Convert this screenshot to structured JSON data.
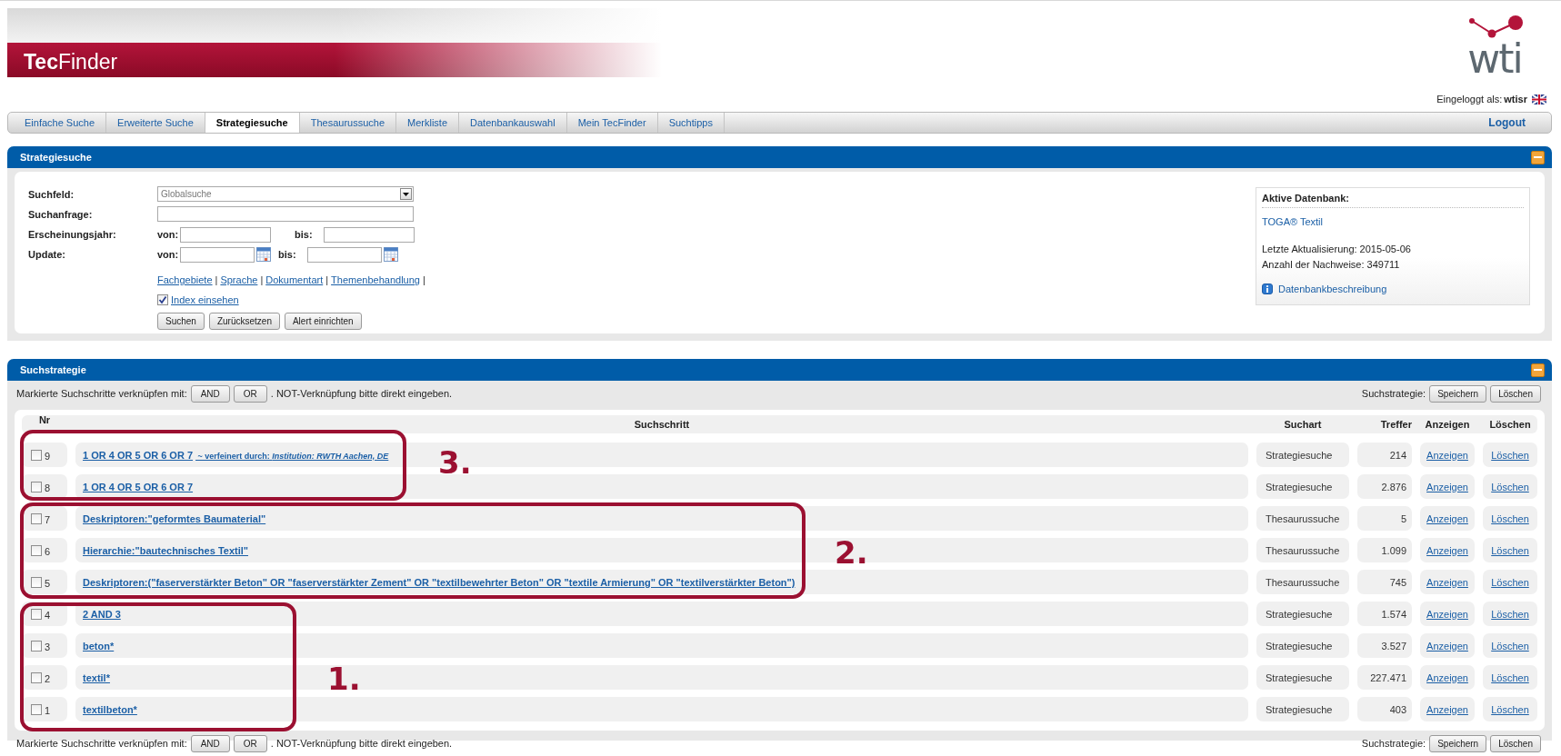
{
  "header": {
    "app_name": "**Tec**Finder",
    "logo": "wti",
    "login_label": "Eingeloggt als:",
    "login_user": "wtisr"
  },
  "tabs": [
    {
      "label": "Einfache Suche",
      "selected": false
    },
    {
      "label": "Erweiterte Suche",
      "selected": false
    },
    {
      "label": "Strategiesuche",
      "selected": true
    },
    {
      "label": "Thesaurussuche",
      "selected": false
    },
    {
      "label": "Merkliste",
      "selected": false
    },
    {
      "label": "Datenbankauswahl",
      "selected": false
    },
    {
      "label": "Mein TecFinder",
      "selected": false
    },
    {
      "label": "Suchtipps",
      "selected": false
    }
  ],
  "logout": "Logout",
  "search_panel": {
    "title": "Strategiesuche",
    "suchfeld": {
      "label": "Suchfeld:",
      "value": "Globalsuche"
    },
    "suchanfrage": {
      "label": "Suchanfrage:"
    },
    "ranges": [
      {
        "label": "Erscheinungsjahr:",
        "from_label": "von:",
        "to_label": "bis:",
        "calendar": false
      },
      {
        "label": "Update:",
        "from_label": "von:",
        "to_label": "bis:",
        "calendar": true
      }
    ],
    "links": [
      "Fachgebiete",
      "Sprache",
      "Dokumentart",
      "Themenbehandlung"
    ],
    "link_separator": "|",
    "index": {
      "label": "Index einsehen",
      "checked": true
    },
    "buttons": [
      "Suchen",
      "Zurücksetzen",
      "Alert einrichten"
    ],
    "database": {
      "title": "Aktive Datenbank:",
      "name": "TOGA® Textil",
      "lines": [
        "Letzte Aktualisierung: 2015-05-06",
        "Anzahl der Nachweise: 349711"
      ],
      "description_link": "Datenbankbeschreibung"
    }
  },
  "strategy_panel": {
    "title": "Suchstrategie",
    "toolbars": [
      {
        "combine_label": "Markierte Suchschritte verknüpfen mit:",
        "buttons": [
          "AND",
          "OR"
        ],
        "note": ". NOT-Verknüpfung bitte direkt eingeben.",
        "save_label": "Suchstrategie:",
        "save_buttons": [
          "Speichern",
          "Löschen"
        ]
      },
      {
        "combine_label": "Markierte Suchschritte verknüpfen mit:",
        "buttons": [
          "AND",
          "OR"
        ],
        "note": ". NOT-Verknüpfung bitte direkt eingeben.",
        "save_label": "Suchstrategie:",
        "save_buttons": [
          "Speichern",
          "Löschen"
        ]
      }
    ],
    "columns": [
      "Nr",
      "Suchschritt",
      "Suchart",
      "Treffer",
      "Anzeigen",
      "Löschen"
    ],
    "rows": [
      {
        "nr": "9",
        "checked": false,
        "step": "1 OR 4 OR 5 OR 6 OR 7",
        "refinement": "~ verfeinert durch: *Institution: RWTH Aachen, DE*",
        "type": "Strategiesuche",
        "hits": "214",
        "show": "Anzeigen",
        "delete": "Löschen"
      },
      {
        "nr": "8",
        "checked": false,
        "step": "1 OR 4 OR 5 OR 6 OR 7",
        "type": "Strategiesuche",
        "hits": "2.876",
        "show": "Anzeigen",
        "delete": "Löschen"
      },
      {
        "nr": "7",
        "checked": false,
        "step": "Deskriptoren:\"geformtes Baumaterial\"",
        "type": "Thesaurussuche",
        "hits": "5",
        "show": "Anzeigen",
        "delete": "Löschen"
      },
      {
        "nr": "6",
        "checked": false,
        "step": "Hierarchie:\"bautechnisches Textil\"",
        "type": "Thesaurussuche",
        "hits": "1.099",
        "show": "Anzeigen",
        "delete": "Löschen"
      },
      {
        "nr": "5",
        "checked": false,
        "step": "Deskriptoren:(\"faserverstärkter Beton\" OR \"faserverstärkter Zement\" OR \"textilbewehrter Beton\" OR \"textile Armierung\" OR \"textilverstärkter Beton\")",
        "type": "Thesaurussuche",
        "hits": "745",
        "show": "Anzeigen",
        "delete": "Löschen"
      },
      {
        "nr": "4",
        "checked": false,
        "step": "2 AND 3",
        "type": "Strategiesuche",
        "hits": "1.574",
        "show": "Anzeigen",
        "delete": "Löschen"
      },
      {
        "nr": "3",
        "checked": false,
        "step": "beton*",
        "type": "Strategiesuche",
        "hits": "3.527",
        "show": "Anzeigen",
        "delete": "Löschen"
      },
      {
        "nr": "2",
        "checked": false,
        "step": "textil*",
        "type": "Strategiesuche",
        "hits": "227.471",
        "show": "Anzeigen",
        "delete": "Löschen"
      },
      {
        "nr": "1",
        "checked": false,
        "step": "textilbeton*",
        "type": "Strategiesuche",
        "hits": "403",
        "show": "Anzeigen",
        "delete": "Löschen"
      }
    ]
  },
  "annotations": [
    {
      "label": "3."
    },
    {
      "label": "2."
    },
    {
      "label": "1."
    }
  ]
}
